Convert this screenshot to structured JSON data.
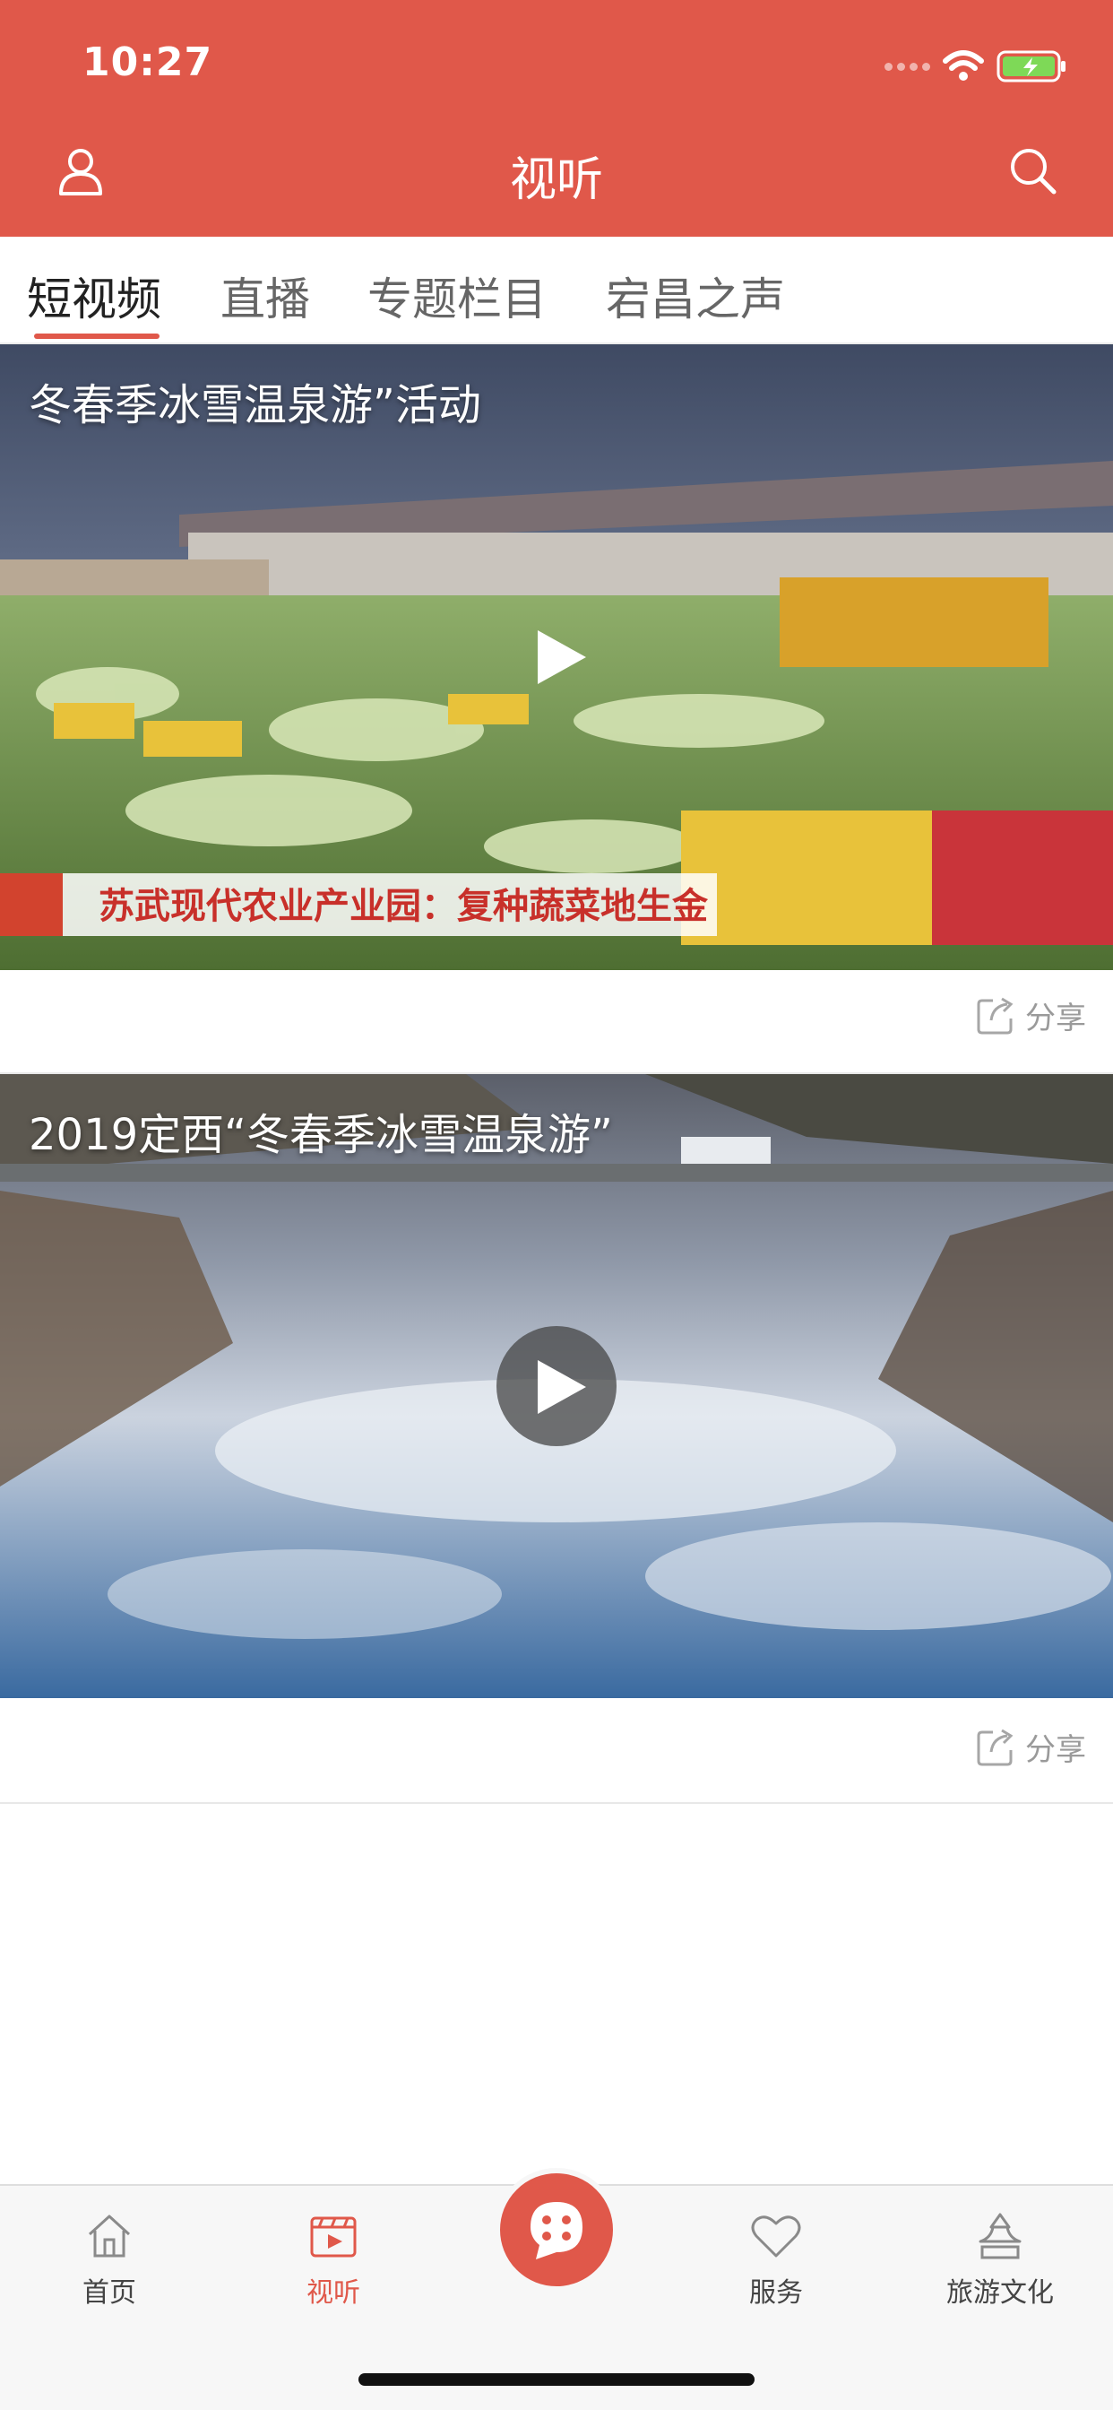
{
  "status_bar": {
    "time": "10:27"
  },
  "nav": {
    "title": "视听"
  },
  "tabs": [
    {
      "label": "短视频"
    },
    {
      "label": "直播"
    },
    {
      "label": "专题栏目"
    },
    {
      "label": "宕昌之声"
    }
  ],
  "videos": [
    {
      "title": "冬春季冰雪温泉游”活动",
      "banner_text": "苏武现代农业产业园：复种蔬菜地生金",
      "share_label": "分享"
    },
    {
      "title": "2019定西“冬春季冰雪温泉游”",
      "share_label": "分享"
    }
  ],
  "tabbar": {
    "home": "首页",
    "av": "视听",
    "service": "服务",
    "tourism": "旅游文化"
  },
  "colors": {
    "accent": "#e0584a"
  }
}
